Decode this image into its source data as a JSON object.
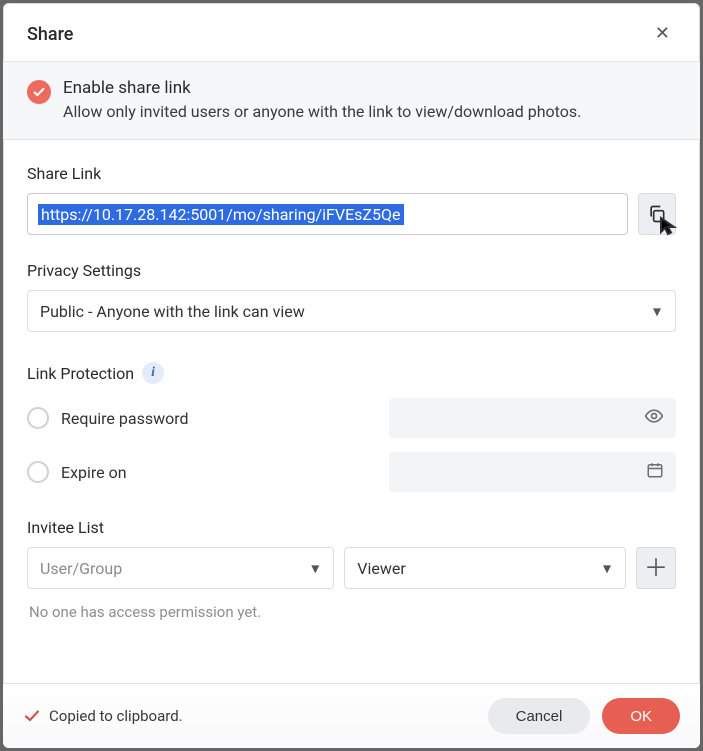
{
  "dialog": {
    "title": "Share"
  },
  "banner": {
    "heading": "Enable share link",
    "sub": "Allow only invited users or anyone with the link to view/download photos."
  },
  "shareLink": {
    "label": "Share Link",
    "url": "https://10.17.28.142:5001/mo/sharing/iFVEsZ5Qe"
  },
  "privacy": {
    "label": "Privacy Settings",
    "selected": "Public - Anyone with the link can view"
  },
  "protection": {
    "label": "Link Protection",
    "passwordLabel": "Require password",
    "expireLabel": "Expire on"
  },
  "invitee": {
    "label": "Invitee List",
    "userPlaceholder": "User/Group",
    "roleSelected": "Viewer",
    "empty": "No one has access permission yet."
  },
  "footer": {
    "toast": "Copied to clipboard.",
    "cancel": "Cancel",
    "ok": "OK"
  }
}
